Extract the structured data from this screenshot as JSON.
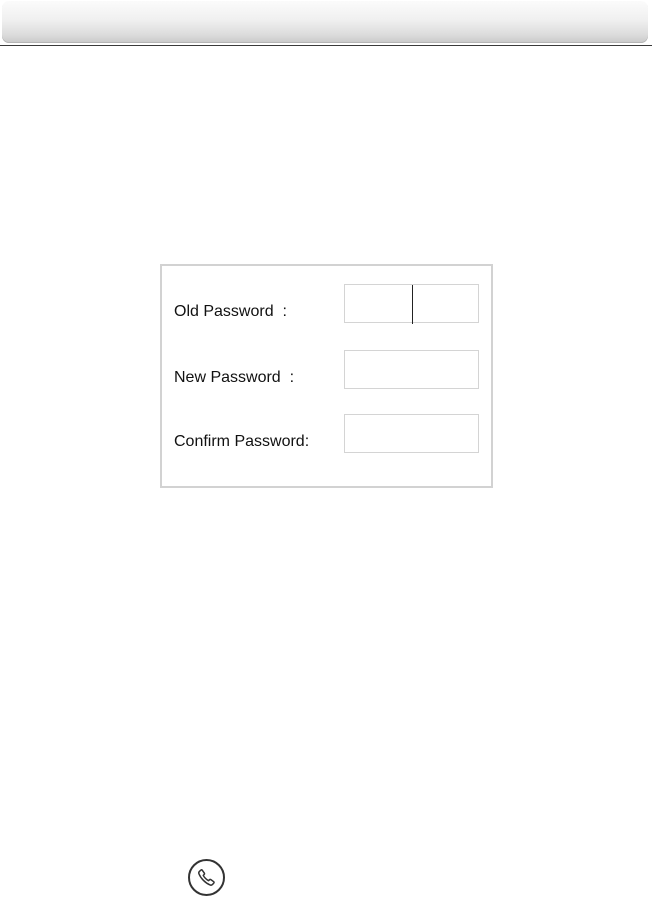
{
  "form": {
    "old_password_label": "Old Password  :",
    "new_password_label": "New Password  :",
    "confirm_password_label": "Confirm Password:",
    "old_password_value": "",
    "new_password_value": "",
    "confirm_password_value": ""
  },
  "icons": {
    "call_button_icon": "phone-icon"
  },
  "colors": {
    "panel_border": "#d2d2d2",
    "field_border": "#d4d4d4",
    "header_gradient_light": "#fbfbfb",
    "header_gradient_dark": "#c9c9c9",
    "text": "#111111"
  }
}
